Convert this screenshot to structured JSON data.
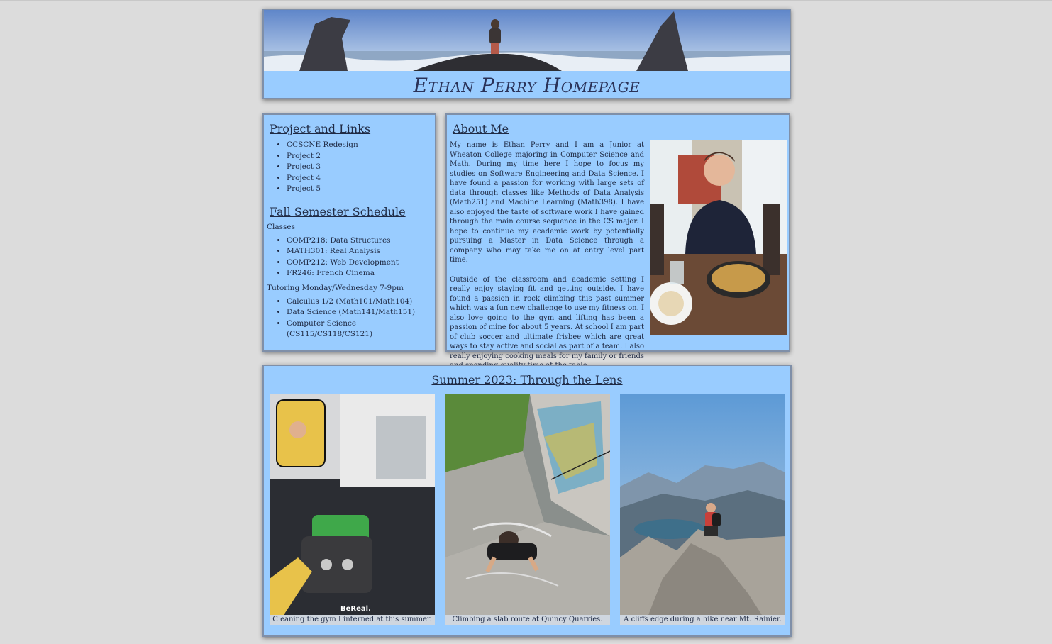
{
  "header": {
    "title": "Ethan Perry Homepage",
    "banner_alt": "sea stacks banner"
  },
  "projects": {
    "heading": "Project and Links",
    "items": [
      "CCSCNE Redesign",
      "Project 2",
      "Project 3",
      "Project 4",
      "Project 5"
    ]
  },
  "schedule": {
    "heading": "Fall Semester Schedule",
    "classes_label": "Classes",
    "classes": [
      "COMP218: Data Structures",
      "MATH301: Real Analysis",
      "COMP212: Web Development",
      "FR246: French Cinema"
    ],
    "tutoring_label": "Tutoring Monday/Wednesday 7-9pm",
    "tutoring": [
      "Calculus 1/2 (Math101/Math104)",
      "Data Science (Math141/Math151)",
      "Computer Science (CS115/CS118/CS121)"
    ]
  },
  "about": {
    "heading": "About Me",
    "paragraph1": "My name is Ethan Perry and I am a Junior at Wheaton College majoring in Computer Science and Math. During my time here I hope to focus my studies on Software Engineering and Data Science. I have found a passion for working with large sets of data through classes like Methods of Data Analysis (Math251) and Machine Learning (Math398). I have also enjoyed the taste of software work I have gained through the main course sequence in the CS major. I hope to continue my academic work by potentially pursuing a Master in Data Science through a company who may take me on at entry level part time.",
    "paragraph2": "Outside of the classroom and academic setting I really enjoy staying fit and getting outside. I have found a passion in rock climbing this past summer which was a fun new challenge to use my fitness on. I also love going to the gym and lifting has been a passion of mine for about 5 years. At school I am part of club soccer and ultimate frisbee which are great ways to stay active and social as part of a team. I also really enjoying cooking meals for my family or friends and spending quality time at the table."
  },
  "summer": {
    "heading": "Summer 2023: Through the Lens",
    "photos": [
      {
        "caption": "Cleaning the gym I interned at this summer.",
        "watermark": "BeReal."
      },
      {
        "caption": "Climbing a slab route at Quincy Quarries."
      },
      {
        "caption": "A cliffs edge during a hike near Mt. Rainier."
      }
    ]
  },
  "colors": {
    "panel": "#99ccff",
    "page": "#dcdcdc",
    "text": "#1f2a44"
  }
}
